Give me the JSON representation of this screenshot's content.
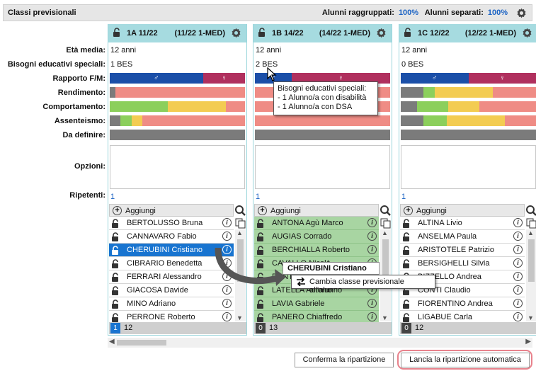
{
  "header": {
    "title": "Classi previsionali",
    "grouped_label": "Alunni raggruppati:",
    "grouped_pct": "100%",
    "separated_label": "Alunni separati:",
    "separated_pct": "100%"
  },
  "row_labels": {
    "eta": "Età media:",
    "bes": "Bisogni educativi speciali:",
    "rapporto": "Rapporto F/M:",
    "rendimento": "Rendimento:",
    "comportamento": "Comportamento:",
    "assenteismo": "Assenteismo:",
    "da_definire": "Da definire:",
    "opzioni": "Opzioni:",
    "ripetenti": "Ripetenti:"
  },
  "colors": {
    "header": "#a6dbe0",
    "male": "#1b4fa8",
    "female": "#b0305e",
    "green": "#8ccf5c",
    "yellow": "#f3cc52",
    "red": "#ef8c85",
    "grey": "#7b7b7b",
    "selected": "#1874d0",
    "moved": "#a8d5a2"
  },
  "classes": [
    {
      "name": "1A 11/22",
      "desc": "(11/22 1-MED)",
      "eta": "12 anni",
      "bes": "1 BES",
      "ratio_f": 0.69,
      "rendimento": [
        0.04,
        0,
        0,
        0.96
      ],
      "comportamento": [
        0.43,
        0.43,
        0,
        0.14
      ],
      "assenteismo": [
        0.08,
        0.08,
        0.08,
        0.76
      ],
      "ripetenti": "1",
      "add_label": "Aggiungi",
      "count": "12",
      "footer_lock": "1",
      "students": [
        {
          "name": "BERTOLUSSO Bruna",
          "state": ""
        },
        {
          "name": "CANNAVARO Fabio",
          "state": ""
        },
        {
          "name": "CHERUBINI Cristiano",
          "state": "sel"
        },
        {
          "name": "CIBRARIO Benedetta",
          "state": ""
        },
        {
          "name": "FERRARI Alessandro",
          "state": ""
        },
        {
          "name": "GIACOSA Davide",
          "state": ""
        },
        {
          "name": "MINO Adriano",
          "state": ""
        },
        {
          "name": "PERRONE Roberto",
          "state": ""
        }
      ]
    },
    {
      "name": "1B 14/22",
      "desc": "(14/22 1-MED)",
      "eta": "12 anni",
      "bes": "2 BES",
      "ratio_f": 0.27,
      "rendimento": [
        0,
        0,
        0,
        1
      ],
      "comportamento": [
        0,
        0,
        0,
        1
      ],
      "assenteismo": [
        0,
        0,
        0,
        1
      ],
      "ripetenti": "1",
      "add_label": "Aggiungi",
      "count": "13",
      "footer_lock": "0",
      "students": [
        {
          "name": "ANTONA Agù Marco",
          "state": "green"
        },
        {
          "name": "AUGIAS Corrado",
          "state": "green"
        },
        {
          "name": "BERCHIALLA Roberto",
          "state": "green"
        },
        {
          "name": "CAVALLO Nicolò",
          "state": "green"
        },
        {
          "name": "DANTE Giuseppe",
          "state": "green"
        },
        {
          "name": "LATELLA Antonio",
          "state": "green"
        },
        {
          "name": "LAVIA Gabriele",
          "state": "green"
        },
        {
          "name": "PANERO Chiaffredo",
          "state": "green"
        }
      ]
    },
    {
      "name": "1C 12/22",
      "desc": "(12/22 1-MED)",
      "eta": "12 anni",
      "bes": "0 BES",
      "ratio_f": 0.5,
      "rendimento": [
        0.17,
        0.08,
        0.43,
        0.32
      ],
      "comportamento": [
        0.23,
        0.23,
        0.12,
        0.42
      ],
      "assenteismo": [
        0.17,
        0.17,
        0.43,
        0.23
      ],
      "ripetenti": "1",
      "add_label": "Aggiungi",
      "count": "12",
      "footer_lock": "0",
      "students": [
        {
          "name": "ALTINA Livio",
          "state": ""
        },
        {
          "name": "ANSELMA Paula",
          "state": ""
        },
        {
          "name": "ARISTOTELE Patrizio",
          "state": ""
        },
        {
          "name": "BERSIGHELLI Silvia",
          "state": ""
        },
        {
          "name": "BIZZELLO Andrea",
          "state": ""
        },
        {
          "name": "CONTI Claudio",
          "state": ""
        },
        {
          "name": "FIORENTINO Andrea",
          "state": ""
        },
        {
          "name": "LIGABUE Carla",
          "state": ""
        }
      ]
    }
  ],
  "tooltip": {
    "title": "Bisogni educativi speciali:",
    "line1": "- 1 Alunno/a con disabilità",
    "line2": "- 1 Alunno/a con DSA"
  },
  "drag": {
    "student_name": "CHERUBINI Cristiano",
    "action": "Cambia classe previsionale all'alunno"
  },
  "buttons": {
    "confirm": "Conferma la ripartizione",
    "auto": "Lancia la ripartizione automatica"
  }
}
